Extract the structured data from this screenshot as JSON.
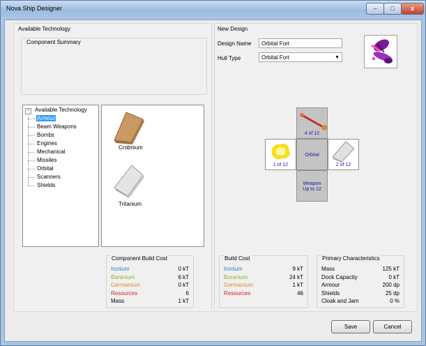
{
  "window": {
    "title": "Nova Ship Designer"
  },
  "title_buttons": {
    "minimize": "–",
    "maximize": "□",
    "close": "x"
  },
  "available_technology": {
    "title": "Available Technology",
    "summary_title": "Component Summary",
    "tree": {
      "root": "Available Technology",
      "items": [
        "Armour",
        "Beam Weapons",
        "Bombs",
        "Engines",
        "Mechanical",
        "Missiles",
        "Orbital",
        "Scanners",
        "Shields"
      ],
      "selected": "Armour"
    },
    "components": [
      {
        "name": "Crobnium",
        "icon": "crobnium-armour-icon",
        "color": "#c89a62"
      },
      {
        "name": "Tritanium",
        "icon": "tritanium-armour-icon",
        "color": "#c8c8c8"
      }
    ],
    "build_cost": {
      "title": "Component Build Cost",
      "rows": [
        {
          "label": "Ironium",
          "value": "0 kT",
          "color": "#2080d0"
        },
        {
          "label": "Boranium",
          "value": "6 kT",
          "color": "#8cb820"
        },
        {
          "label": "Germanium",
          "value": "0 kT",
          "color": "#e08830"
        },
        {
          "label": "Resources",
          "value": "6",
          "color": "#d82020"
        },
        {
          "label": "Mass",
          "value": "1 kT",
          "color": "#000000"
        }
      ]
    }
  },
  "new_design": {
    "title": "New Design",
    "design_name_label": "Design Name",
    "design_name_value": "Orbital Fort",
    "hull_type_label": "Hull Type",
    "hull_type_value": "Orbital Fort",
    "hull_icon": "orbital-fort-hull-icon",
    "slots": {
      "top": {
        "text": "4 of 12",
        "icon": "beam-weapon-icon"
      },
      "left": {
        "text": "1 of 12",
        "icon": "yellow-explosion-icon"
      },
      "center": {
        "text": "Orbital"
      },
      "right": {
        "text": "2 of 12",
        "icon": "tritanium-armour-icon"
      },
      "bottom": {
        "line1": "Weapon",
        "line2": "Up to 12"
      }
    },
    "build_cost": {
      "title": "Build Cost",
      "rows": [
        {
          "label": "Ironium",
          "value": "9 kT",
          "color": "#2080d0"
        },
        {
          "label": "Boranium",
          "value": "24 kT",
          "color": "#8cb820"
        },
        {
          "label": "Germanium",
          "value": "1 kT",
          "color": "#e08830"
        },
        {
          "label": "Resources",
          "value": "46",
          "color": "#d82020"
        }
      ]
    },
    "primary": {
      "title": "Primary Characteristics",
      "rows": [
        {
          "label": "Mass",
          "value": "125 kT"
        },
        {
          "label": "Dock Capacity",
          "value": "0 kT"
        },
        {
          "label": "Armour",
          "value": "200 dp"
        },
        {
          "label": "Shields",
          "value": "25 dp"
        },
        {
          "label": "Cloak and Jam",
          "value": "0  %"
        }
      ]
    }
  },
  "buttons": {
    "save": "Save",
    "cancel": "Cancel"
  }
}
